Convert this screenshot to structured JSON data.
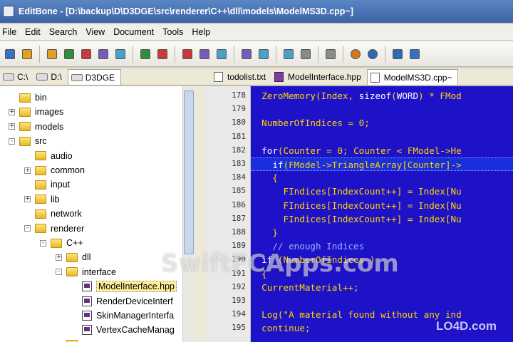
{
  "window": {
    "title": "EditBone - [D:\\backup\\D\\D3DGE\\src\\renderer\\C++\\dll\\models\\ModelMS3D.cpp~]"
  },
  "menu": [
    "File",
    "Edit",
    "Search",
    "View",
    "Document",
    "Tools",
    "Help"
  ],
  "toolbar": {
    "groups": [
      [
        "new-file-icon",
        "open-file-icon"
      ],
      [
        "save-icon",
        "save-as-icon",
        "save-all-icon",
        "close-icon",
        "close-all-icon"
      ],
      [
        "print-icon",
        "print-preview-icon"
      ],
      [
        "add-bookmark-icon",
        "remove-bookmark-icon",
        "bookmark-list-icon"
      ],
      [
        "indent-icon",
        "outdent-icon"
      ],
      [
        "sort-asc-icon",
        "sort-desc-icon"
      ],
      [
        "toggle-case-icon"
      ],
      [
        "undo-icon",
        "redo-icon"
      ],
      [
        "search-icon",
        "replace-icon"
      ]
    ]
  },
  "drive_tabs": [
    {
      "label": "C:\\",
      "active": false
    },
    {
      "label": "D:\\",
      "active": false
    },
    {
      "label": "D3DGE",
      "active": true
    }
  ],
  "file_tabs": [
    {
      "label": "todolist.txt",
      "icon": "text-file-icon",
      "active": false
    },
    {
      "label": "ModelInterface.hpp",
      "icon": "cpp-file-icon",
      "active": false
    },
    {
      "label": "ModelMS3D.cpp~",
      "icon": "text-file-icon",
      "active": true
    }
  ],
  "tree": [
    {
      "label": "bin",
      "level": 0,
      "expander": "",
      "type": "folder"
    },
    {
      "label": "images",
      "level": 0,
      "expander": "+",
      "type": "folder"
    },
    {
      "label": "models",
      "level": 0,
      "expander": "+",
      "type": "folder"
    },
    {
      "label": "src",
      "level": 0,
      "expander": "-",
      "type": "folder"
    },
    {
      "label": "audio",
      "level": 1,
      "expander": "",
      "type": "folder"
    },
    {
      "label": "common",
      "level": 1,
      "expander": "+",
      "type": "folder"
    },
    {
      "label": "input",
      "level": 1,
      "expander": "",
      "type": "folder"
    },
    {
      "label": "lib",
      "level": 1,
      "expander": "+",
      "type": "folder"
    },
    {
      "label": "network",
      "level": 1,
      "expander": "",
      "type": "folder"
    },
    {
      "label": "renderer",
      "level": 1,
      "expander": "-",
      "type": "folder"
    },
    {
      "label": "C++",
      "level": 2,
      "expander": "-",
      "type": "folder"
    },
    {
      "label": "dll",
      "level": 3,
      "expander": "+",
      "type": "folder"
    },
    {
      "label": "interface",
      "level": 3,
      "expander": "-",
      "type": "folder"
    },
    {
      "label": "ModelInterface.hpp",
      "level": 4,
      "expander": "",
      "type": "file",
      "selected": true
    },
    {
      "label": "RenderDeviceInterf",
      "level": 4,
      "expander": "",
      "type": "file"
    },
    {
      "label": "SkinManagerInterfa",
      "level": 4,
      "expander": "",
      "type": "file"
    },
    {
      "label": "VertexCacheManag",
      "level": 4,
      "expander": "",
      "type": "file"
    },
    {
      "label": "",
      "level": 3,
      "expander": "",
      "type": "folder"
    }
  ],
  "editor": {
    "lines": [
      {
        "n": "178",
        "text": "  ZeroMemory(Index, sizeof(WORD) * FMod",
        "current": false
      },
      {
        "n": "179",
        "text": "",
        "current": false
      },
      {
        "n": "180",
        "text": "  NumberOfIndices = 0;",
        "current": false
      },
      {
        "n": "181",
        "text": "",
        "current": false
      },
      {
        "n": "182",
        "text": "  for(Counter = 0; Counter < FModel->He",
        "current": false
      },
      {
        "n": "183",
        "text": "    if(FModel->TriangleArray[Counter]->",
        "current": true
      },
      {
        "n": "184",
        "text": "    {",
        "current": false
      },
      {
        "n": "185",
        "text": "      FIndices[IndexCount++] = Index[Nu",
        "current": false
      },
      {
        "n": "186",
        "text": "      FIndices[IndexCount++] = Index[Nu",
        "current": false
      },
      {
        "n": "187",
        "text": "      FIndices[IndexCount++] = Index[Nu",
        "current": false
      },
      {
        "n": "188",
        "text": "    }",
        "current": false
      },
      {
        "n": "189",
        "text": "    // enough Indices",
        "current": false
      },
      {
        "n": "190",
        "text": "  if (NumberOfIndices )",
        "current": false
      },
      {
        "n": "191",
        "text": "  {",
        "current": false
      },
      {
        "n": "192",
        "text": "  CurrentMaterial++;",
        "current": false
      },
      {
        "n": "193",
        "text": "",
        "current": false
      },
      {
        "n": "194",
        "text": "  Log(\"A material found without any ind",
        "current": false
      },
      {
        "n": "195",
        "text": "  continue;",
        "current": false
      }
    ]
  },
  "watermarks": {
    "main": "SwiftFCApps.com",
    "corner": "LO4D.com"
  }
}
